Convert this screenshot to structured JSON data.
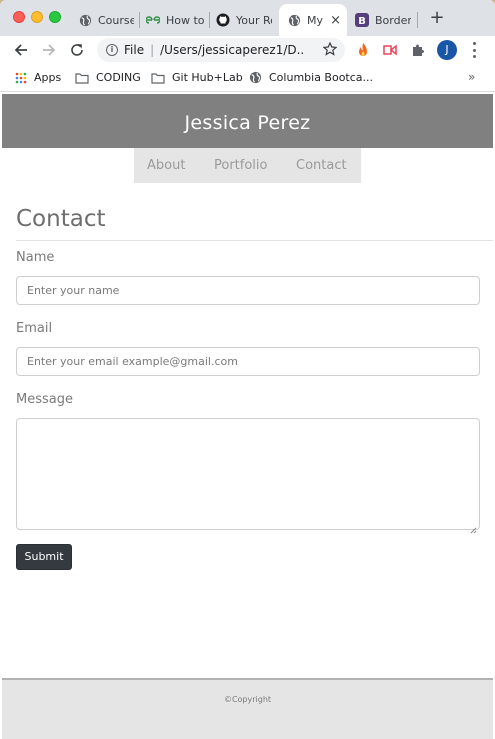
{
  "browser": {
    "tabs": [
      {
        "label": "Course",
        "icon": "globe-icon"
      },
      {
        "label": "How to",
        "icon": "geeksforgeeks-icon"
      },
      {
        "label": "Your Re",
        "icon": "github-icon"
      },
      {
        "label": "My",
        "icon": "globe-icon",
        "active": true
      },
      {
        "label": "Border",
        "icon": "bootstrap-icon"
      }
    ],
    "tab_close": "×",
    "new_tab": "+",
    "address": {
      "scheme_label": "File",
      "url": "/Users/jessicaperez1/D..."
    },
    "profile_initial": "J",
    "bookmarks": [
      {
        "label": "Apps",
        "icon": "apps-grid-icon"
      },
      {
        "label": "CODING",
        "icon": "folder-icon"
      },
      {
        "label": "Git Hub+Lab",
        "icon": "folder-icon"
      },
      {
        "label": "Columbia Bootca...",
        "icon": "globe-icon"
      }
    ],
    "bookmarks_overflow": "»"
  },
  "site": {
    "header_title": "Jessica Perez",
    "nav": [
      "About",
      "Portfolio",
      "Contact"
    ],
    "page_title": "Contact",
    "form": {
      "name_label": "Name",
      "name_placeholder": "Enter your name",
      "email_label": "Email",
      "email_placeholder": "Enter your email example@gmail.com",
      "message_label": "Message",
      "submit_label": "Submit"
    },
    "footer_text": "©Copyright"
  },
  "colors": {
    "header_bg": "#808080",
    "nav_bg": "#e5e5e5",
    "button_bg": "#343a40",
    "footer_bg": "#e5e5e5",
    "profile_bg": "#1a56a6"
  }
}
